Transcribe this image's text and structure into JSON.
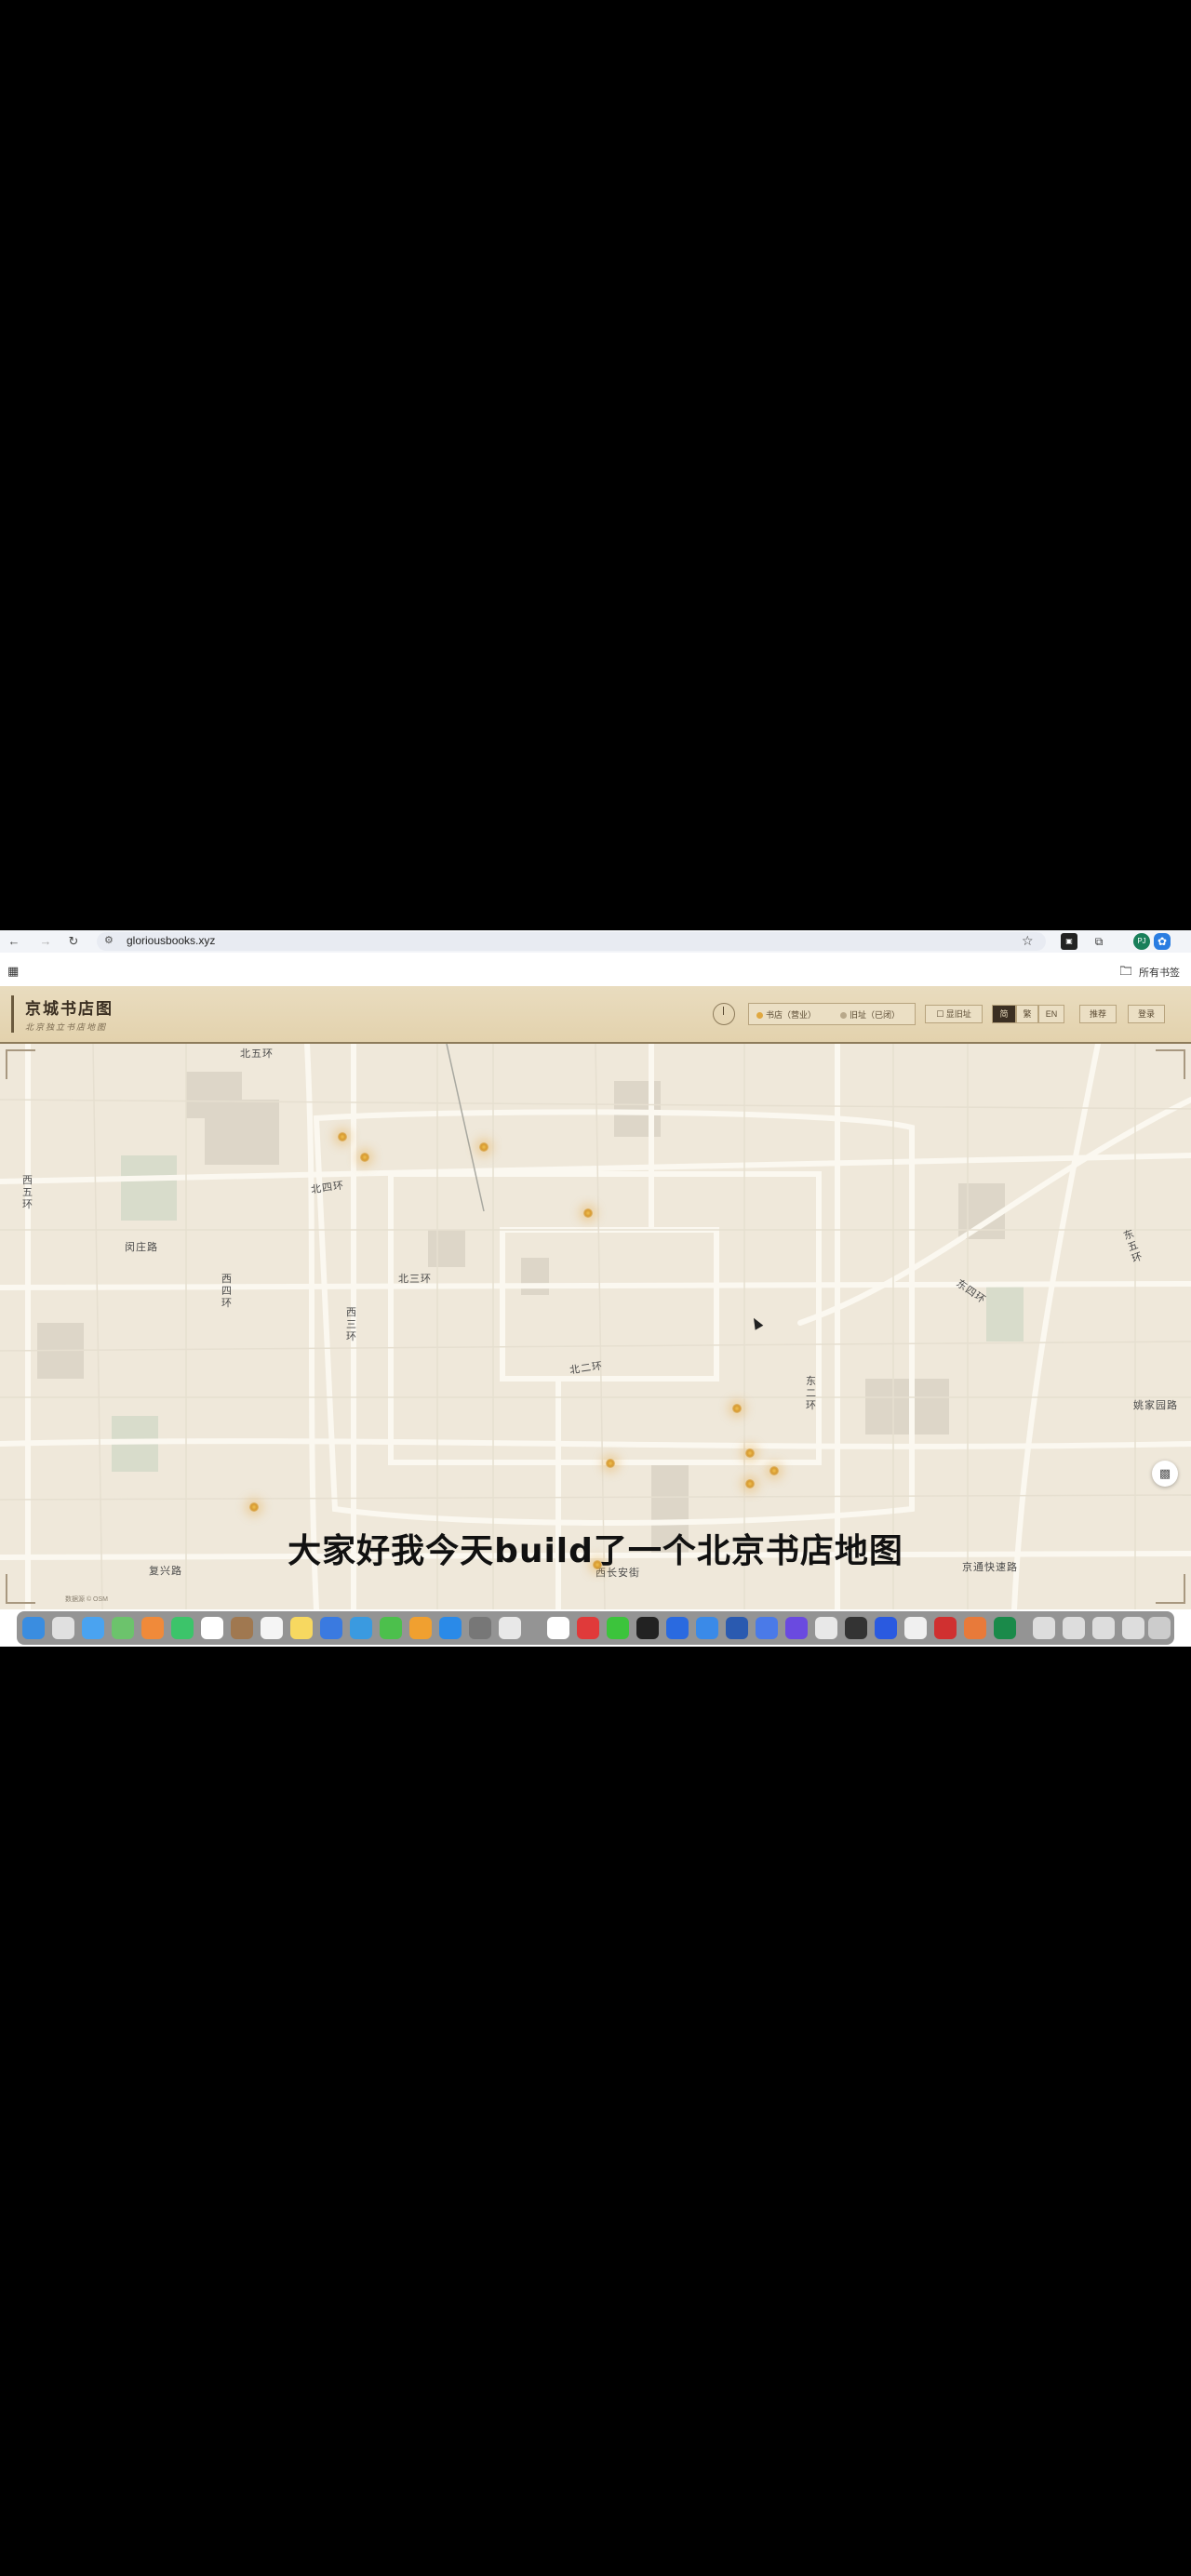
{
  "browser": {
    "url": "gloriousbooks.xyz",
    "back_icon": "arrow-left-icon",
    "forward_icon": "arrow-right-icon",
    "reload_icon": "reload-icon",
    "all_bookmarks_label": "所有书签"
  },
  "header": {
    "title": "京城书店图",
    "subtitle": "北京独立书店地图",
    "legend": {
      "open_label": "书店（营业）",
      "closed_label": "旧址（已闭）"
    },
    "toggle_label": "显旧址",
    "lang_options": [
      "简",
      "繁",
      "EN"
    ],
    "active_lang": "简",
    "recommend_label": "推荐",
    "login_label": "登录"
  },
  "map": {
    "road_labels": {
      "beiwuhuan": "北五环",
      "beisihuan": "北四环",
      "xiwuhuan": "西五环",
      "minzhuang": "闵庄路",
      "xisihuan": "西四环",
      "beisanhuan": "北三环",
      "xisanhuan": "西三环",
      "beierhuan": "北二环",
      "dongerhuan": "东二环",
      "dongsihuan": "东四环",
      "dongwuhuan": "东五环",
      "chaoyang": "姚家园路",
      "fuxing": "复兴路",
      "xichangan": "西长安街",
      "jingtong": "京通快速路"
    },
    "attribution": "数据源 © OSM",
    "pin_count": 12
  },
  "caption": "大家好我今天build了一个北京书店地图",
  "colors": {
    "header_bg": "#e6d7b6",
    "map_bg": "#efe8da",
    "pin": "#d79a30",
    "brand_text": "#3b2f22"
  }
}
